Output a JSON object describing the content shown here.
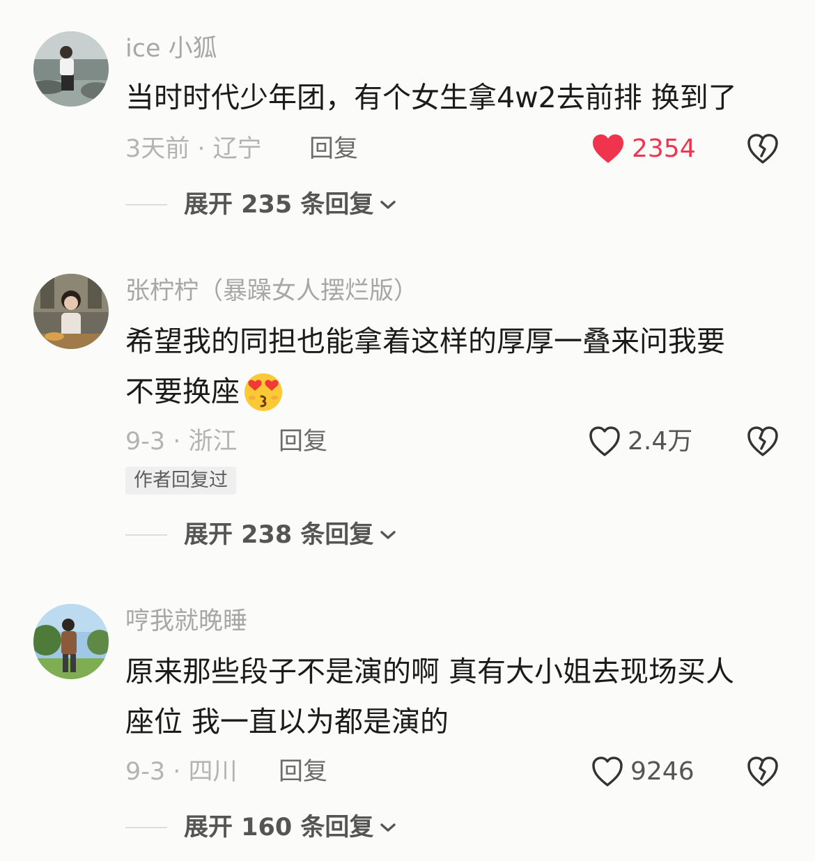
{
  "comments": [
    {
      "username": "ice 小狐",
      "lines": [
        "当时时代少年团，有个女生拿4w2去前排 换到了"
      ],
      "time_location": "3天前 · 辽宁",
      "reply_label": "回复",
      "like_count": "2354",
      "liked": true,
      "author_replied": "",
      "expand_label": "展开 235 条回复"
    },
    {
      "username": "张柠柠（暴躁女人摆烂版）",
      "lines": [
        "希望我的同担也能拿着这样的厚厚一叠来问我要",
        "不要换座"
      ],
      "time_location": "9-3 · 浙江",
      "reply_label": "回复",
      "like_count": "2.4万",
      "liked": false,
      "author_replied": "作者回复过",
      "expand_label": "展开 238 条回复"
    },
    {
      "username": "哼我就晚睡",
      "lines": [
        "原来那些段子不是演的啊 真有大小姐去现场买人",
        "座位 我一直以为都是演的"
      ],
      "time_location": "9-3 · 四川",
      "reply_label": "回复",
      "like_count": "9246",
      "liked": false,
      "author_replied": "",
      "expand_label": "展开 160 条回复"
    }
  ],
  "icons": {
    "heart": "heart-icon",
    "broken_heart": "broken-heart-icon",
    "chevron": "chevron-down-icon",
    "emoji": "heart-eyes-kiss-emoji"
  },
  "colors": {
    "liked_heart": "#f0344d",
    "username": "#a7a7a7",
    "text": "#1b1b1b",
    "meta": "#b3b3b3"
  }
}
